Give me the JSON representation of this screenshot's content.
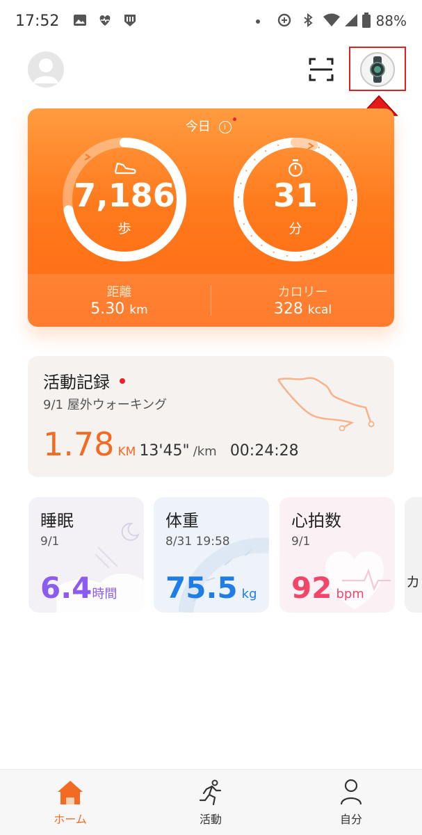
{
  "status_bar": {
    "time": "17:52",
    "battery": "88%"
  },
  "today": {
    "title": "今日",
    "steps": {
      "value": "7,186",
      "unit": "歩",
      "progress": 0.72
    },
    "minutes": {
      "value": "31",
      "unit": "分",
      "progress": 0.05
    },
    "distance": {
      "label": "距離",
      "value": "5.30",
      "unit": "km"
    },
    "calories": {
      "label": "カロリー",
      "value": "328",
      "unit": "kcal"
    }
  },
  "record": {
    "title": "活動記録",
    "subtitle": "9/1  屋外ウォーキング",
    "distance": "1.78",
    "distance_unit": "KM",
    "pace": "13'45\"",
    "pace_unit": "/km",
    "duration": "00:24:28"
  },
  "cards": {
    "sleep": {
      "title": "睡眠",
      "date": "9/1",
      "value": "6.4",
      "unit": "時間",
      "color": "#8a5cf0"
    },
    "weight": {
      "title": "体重",
      "date": "8/31 19:58",
      "value": "75.5",
      "unit": "kg",
      "color": "#1e7de6"
    },
    "heart": {
      "title": "心拍数",
      "date": "9/1",
      "value": "92",
      "unit": "bpm",
      "color": "#f0466a"
    },
    "partial_label": "カ"
  },
  "nav": {
    "home": "ホーム",
    "activity": "活動",
    "me": "自分",
    "accent": "#f36a22"
  }
}
